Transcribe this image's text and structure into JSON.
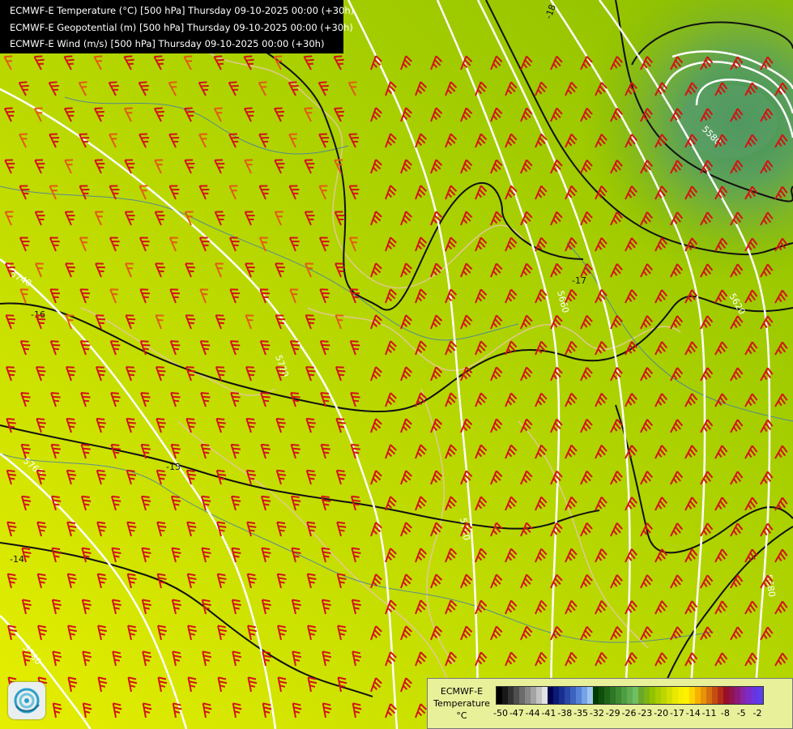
{
  "titles": [
    "ECMWF-E Temperature (°C) [500 hPa] Thursday 09-10-2025 00:00 (+30h)",
    "ECMWF-E Geopotential (m) [500 hPa] Thursday 09-10-2025 00:00 (+30h)",
    "ECMWF-E Wind (m/s) [500 hPa] Thursday 09-10-2025 00:00 (+30h)"
  ],
  "legend": {
    "model": "ECMWF-E",
    "variable": "Temperature",
    "unit": "°C",
    "ticks": [
      "-50",
      "-47",
      "-44",
      "-41",
      "-38",
      "-35",
      "-32",
      "-29",
      "-26",
      "-23",
      "-20",
      "-17",
      "-14",
      "-11",
      "-8",
      "-5",
      "-2"
    ],
    "colors": [
      "#000000",
      "#181818",
      "#333333",
      "#4f4f4f",
      "#6b6b6b",
      "#878787",
      "#a3a3a3",
      "#c2c2c2",
      "#e2e2e2",
      "#000050",
      "#0a1a75",
      "#17308f",
      "#2a48a8",
      "#3d63c0",
      "#5581d6",
      "#74a3e6",
      "#9fc6f2",
      "#003b00",
      "#0f4f0c",
      "#1f6318",
      "#2e7725",
      "#3d8a33",
      "#4d9d42",
      "#5fae52",
      "#72be63",
      "#6aa82a",
      "#7db515",
      "#93c200",
      "#a8cd00",
      "#bdd600",
      "#d3df00",
      "#e7e900",
      "#f6f000",
      "#fff200",
      "#ffd400",
      "#f5b300",
      "#e8920a",
      "#d6700e",
      "#c24e12",
      "#b02d16",
      "#9a0e28",
      "#8f1450",
      "#8b1a7a",
      "#8a24a5",
      "#7a2cc8",
      "#6a35e0",
      "#5b3fe8"
    ]
  },
  "map": {
    "geopotential_labels": [
      "5740",
      "5720",
      "5760",
      "5700",
      "5780",
      "5660",
      "5620",
      "5680",
      "5580",
      "5670"
    ],
    "temperature_labels": [
      "-16",
      "-15",
      "-14",
      "-17",
      "-18",
      "-17",
      "-19",
      "-16"
    ]
  }
}
